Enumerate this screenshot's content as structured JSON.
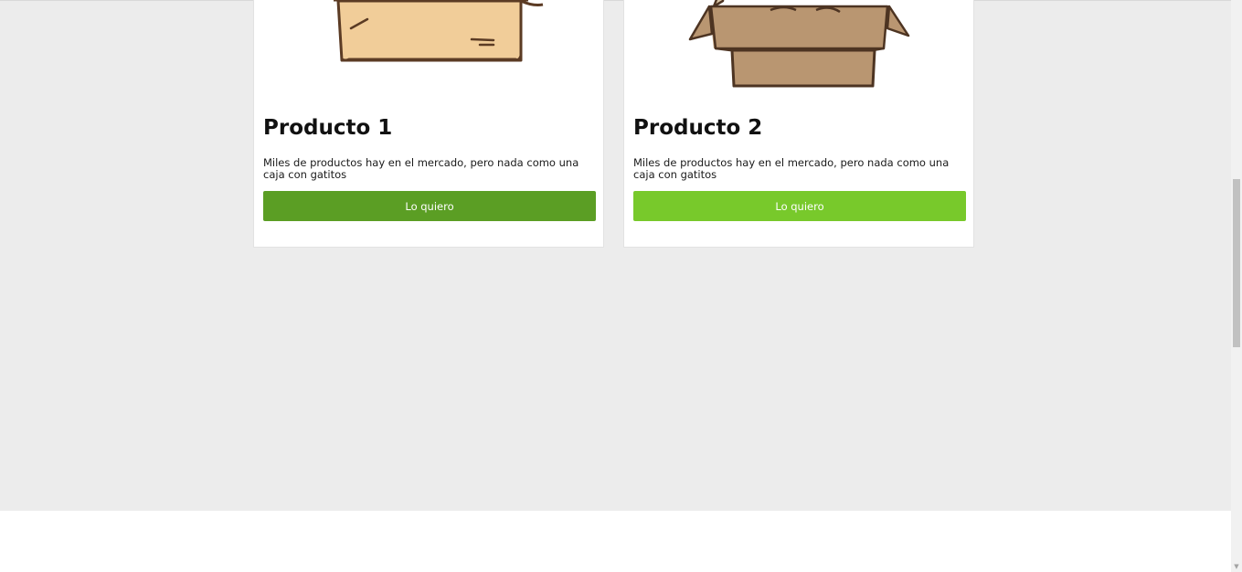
{
  "products": [
    {
      "title": "Producto 1",
      "description": "Miles de productos hay en el mercado, pero nada como una caja con gatitos",
      "button_label": "Lo quiero",
      "button_color": "#5b9e24",
      "image_icon": "open-box-icon"
    },
    {
      "title": "Producto 2",
      "description": "Miles de productos hay en el mercado, pero nada como una caja con gatitos",
      "button_label": "Lo quiero",
      "button_color": "#78c92b",
      "image_icon": "cardboard-box-with-cat-icon"
    }
  ],
  "colors": {
    "background": "#ececec",
    "card": "#ffffff",
    "footer": "#ffffff"
  }
}
